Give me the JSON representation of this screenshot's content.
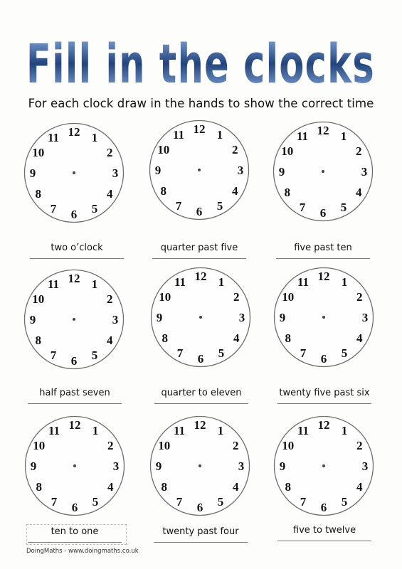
{
  "worksheet": {
    "title": "Fill in the clocks",
    "subtitle": "For each clock draw in the hands to show the correct time",
    "title_colors": {
      "light": "#8fb2e3",
      "dark": "#22447c"
    },
    "clock_numerals": [
      "12",
      "1",
      "2",
      "3",
      "4",
      "5",
      "6",
      "7",
      "8",
      "9",
      "10",
      "11"
    ],
    "clocks": [
      {
        "label": "two o’clock"
      },
      {
        "label": "quarter past five"
      },
      {
        "label": "five past ten"
      },
      {
        "label": "half past seven"
      },
      {
        "label": "quarter to eleven"
      },
      {
        "label": "twenty five past six"
      },
      {
        "label": "ten to one"
      },
      {
        "label": "twenty past four"
      },
      {
        "label": "five to twelve"
      }
    ],
    "selected_label_index": 6,
    "footer": "DoingMaths - www.doingmaths.co.uk"
  }
}
